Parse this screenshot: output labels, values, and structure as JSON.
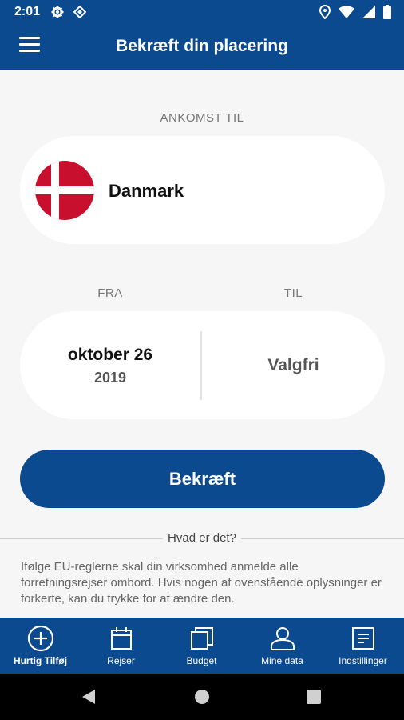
{
  "status_bar": {
    "time": "2:01",
    "left_icons": [
      "gear-icon",
      "diamond-icon"
    ],
    "right_icons": [
      "location-icon",
      "wifi-icon",
      "signal-icon",
      "battery-icon"
    ]
  },
  "header": {
    "title": "Bekræft din placering",
    "menu_icon": "hamburger-icon"
  },
  "arrival": {
    "label": "ANKOMST TIL",
    "country": "Danmark",
    "flag": "denmark-flag"
  },
  "dates": {
    "from_label": "FRA",
    "to_label": "TIL",
    "from_month_day": "oktober 26",
    "from_year": "2019",
    "to_value": "Valgfri"
  },
  "confirm_button": "Bekræft",
  "info": {
    "heading": "Hvad er det?",
    "body": "Ifølge EU-reglerne skal din virksomhed anmelde alle forretningsrejser ombord. Hvis nogen af ovenstående oplysninger er forkerte, kan du trykke for at ændre den."
  },
  "bottom_nav": {
    "items": [
      {
        "label": "Hurtig Tilføj",
        "icon": "plus-circle-icon"
      },
      {
        "label": "Rejser",
        "icon": "calendar-icon"
      },
      {
        "label": "Budget",
        "icon": "copy-icon"
      },
      {
        "label": "Mine data",
        "icon": "user-icon"
      },
      {
        "label": "Indstillinger",
        "icon": "document-icon"
      }
    ]
  },
  "system_nav": [
    "back-icon",
    "home-icon",
    "recents-icon"
  ],
  "colors": {
    "primary": "#0b4a8f",
    "background": "#f6f6f6",
    "flag_red": "#c8102e"
  }
}
